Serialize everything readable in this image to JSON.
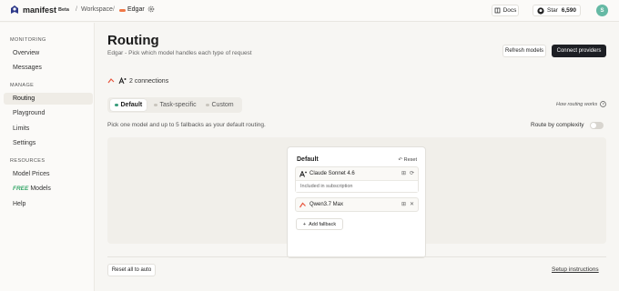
{
  "topbar": {
    "brand": "manifest",
    "beta": "Beta",
    "breadcrumb_sep": "/",
    "workspace": "Workspace",
    "agent": "Edgar",
    "docs_label": "Docs",
    "star_label": "Star",
    "star_count": "6,590",
    "avatar_initial": "S"
  },
  "sidebar": {
    "monitoring_label": "MONITORING",
    "monitoring": [
      "Overview",
      "Messages"
    ],
    "manage_label": "MANAGE",
    "manage": [
      "Routing",
      "Playground",
      "Limits",
      "Settings"
    ],
    "resources_label": "RESOURCES",
    "resources": {
      "model_prices": "Model Prices",
      "free_tag": "FREE",
      "free_models": "Models",
      "help": "Help"
    },
    "active": "Routing"
  },
  "main": {
    "title": "Routing",
    "subtitle": "Edgar - Pick which model handles each type of request",
    "refresh_label": "Refresh models",
    "connect_label": "Connect providers",
    "connections": "2 connections",
    "tabs": [
      "Default",
      "Task-specific",
      "Custom"
    ],
    "active_tab": "Default",
    "how_routing": "How routing works",
    "hint": "Pick one model and up to 5 fallbacks as your default routing.",
    "complexity_label": "Route by complexity",
    "complexity_on": false,
    "card": {
      "title": "Default",
      "reset": "Reset",
      "primary_model": "Claude Sonnet 4.6",
      "primary_note": "Included in subscription",
      "fallback_model": "Qwen3.7 Max",
      "add_fallback": "Add fallback"
    },
    "reset_all": "Reset all to auto",
    "setup": "Setup instructions"
  },
  "colors": {
    "accent_dark": "#1d1f24",
    "active_dot": "#3a9d7c",
    "free": "#39a86b",
    "avatar": "#65b9a4"
  }
}
